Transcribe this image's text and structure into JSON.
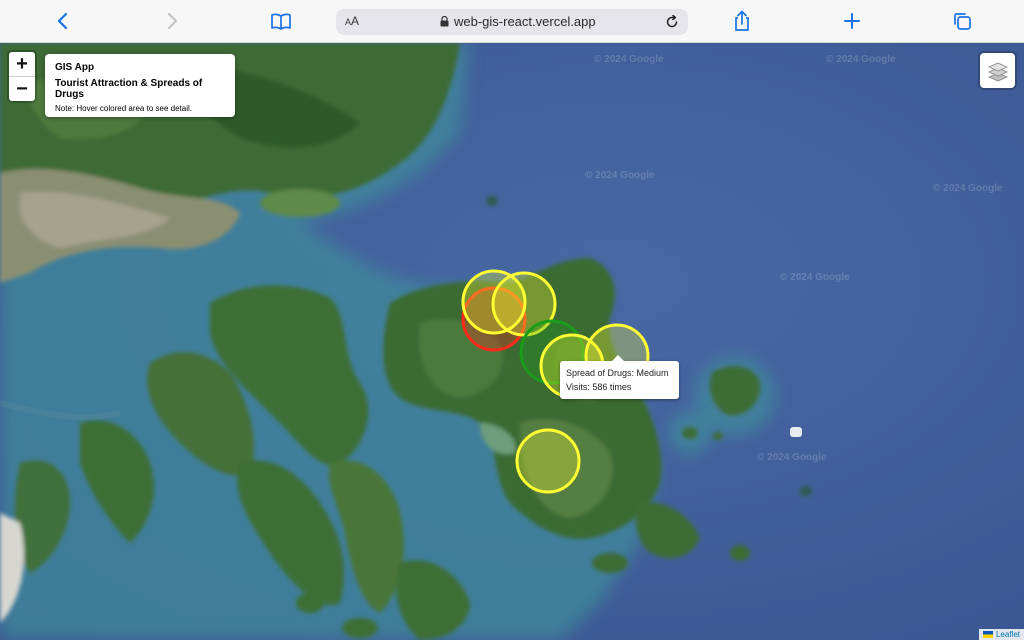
{
  "browser": {
    "text_size_label": "AA",
    "url": "web-gis-react.vercel.app",
    "icons": [
      "back-icon",
      "forward-icon",
      "bookmarks-icon",
      "lock-icon",
      "reload-icon",
      "share-icon",
      "new-tab-icon",
      "tabs-icon"
    ]
  },
  "map": {
    "zoom_in": "+",
    "zoom_out": "−",
    "watermark": "© 2024 Google",
    "info": {
      "title": "GIS App",
      "subtitle": "Tourist Attraction & Spreads of Drugs",
      "note": "Note: Hover colored area to see detail."
    },
    "tooltip": {
      "line1": "Spread of Drugs: Medium",
      "line2": "Visits: 586 times"
    },
    "attribution": "Leaflet",
    "marker_colors": {
      "high": "#ff2a1a",
      "medium": "#ffff33",
      "low": "#1a9c1a"
    }
  }
}
